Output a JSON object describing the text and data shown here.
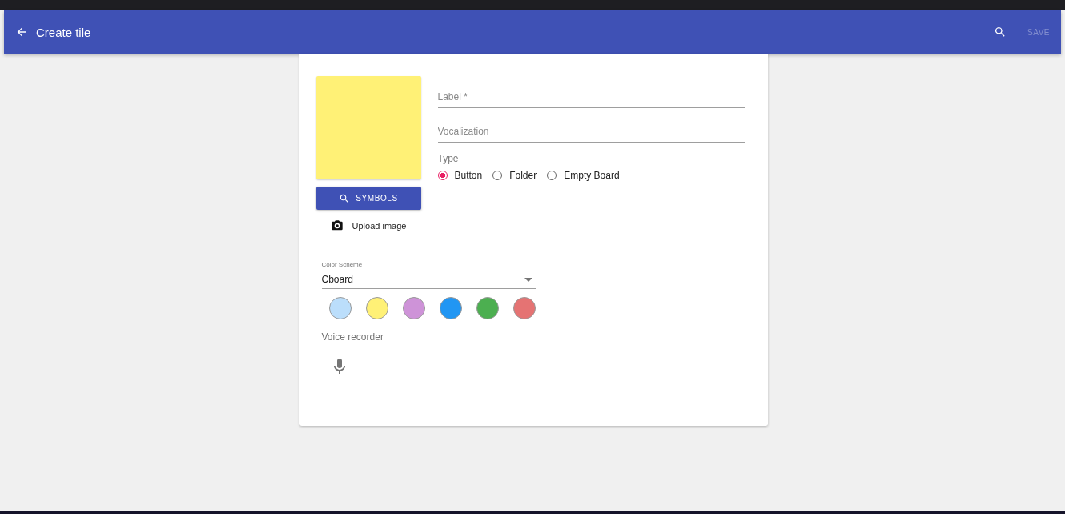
{
  "app_bar": {
    "title": "Create tile",
    "save": {
      "label": "SAVE",
      "disabled": true
    }
  },
  "tile_preview": {
    "color": "#fff176"
  },
  "symbols_button": "SYMBOLS",
  "upload_image": "Upload image",
  "fields": [
    {
      "placeholder": "Label *"
    },
    {
      "placeholder": "Vocalization"
    }
  ],
  "type": {
    "label": "Type",
    "options": [
      {
        "label": "Button",
        "selected": true
      },
      {
        "label": "Folder",
        "selected": false
      },
      {
        "label": "Empty Board",
        "selected": false
      }
    ]
  },
  "color_scheme": {
    "label": "Color Scheme",
    "value": "Cboard"
  },
  "swatches": [
    {
      "color": "#bbdefb"
    },
    {
      "color": "#fff176"
    },
    {
      "color": "#ce93d8"
    },
    {
      "color": "#2196f3"
    },
    {
      "color": "#4caf50"
    },
    {
      "color": "#e57373"
    }
  ],
  "voice_recorder": {
    "label": "Voice recorder"
  }
}
